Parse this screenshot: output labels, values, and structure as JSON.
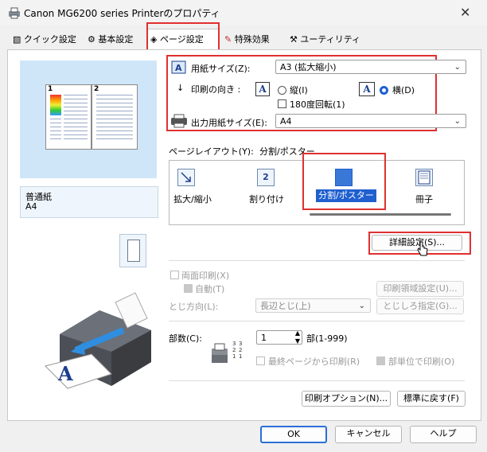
{
  "window": {
    "title": "Canon MG6200 series Printerのプロパティ",
    "close": "✕"
  },
  "tabs": [
    {
      "label": "クイック設定"
    },
    {
      "label": "基本設定"
    },
    {
      "label": "ページ設定"
    },
    {
      "label": "特殊効果"
    },
    {
      "label": "ユーティリティ"
    }
  ],
  "preview": {
    "page1": "1",
    "page2": "2"
  },
  "paper_info": {
    "type": "普通紙",
    "size": "A4"
  },
  "page_size": {
    "label": "用紙サイズ(Z):",
    "value": "A3 (拡大縮小)"
  },
  "orientation": {
    "label": "印刷の向き :",
    "portrait": "縦(I)",
    "landscape": "横(D)",
    "rotate": "180度回転(1)",
    "icon": "A"
  },
  "output_size": {
    "label": "出力用紙サイズ(E):",
    "value": "A4"
  },
  "page_layout": {
    "label": "ページレイアウト(Y):",
    "value": "分割/ポスター",
    "items": [
      {
        "label": "拡大/縮小"
      },
      {
        "label": "割り付け"
      },
      {
        "label": "分割/ポスター"
      },
      {
        "label": "冊子"
      }
    ],
    "icon2": "2"
  },
  "details_button": "詳細設定(S)...",
  "duplex": {
    "label": "両面印刷(X)",
    "auto": "自動(T)",
    "area_button": "印刷領域設定(U)...",
    "binding_label": "とじ方向(L):",
    "binding_value": "長辺とじ(上)",
    "margin_button": "とじしろ指定(G)..."
  },
  "copies": {
    "label": "部数(C):",
    "value": "1",
    "range": "部(1-999)",
    "last_page": "最終ページから印刷(R)",
    "collate": "部単位で印刷(O)"
  },
  "bottom_buttons": {
    "print_options": "印刷オプション(N)...",
    "defaults": "標準に戻す(F)"
  },
  "dialog_buttons": {
    "ok": "OK",
    "cancel": "キャンセル",
    "help": "ヘルプ"
  },
  "colors": {
    "highlight": "#1f5fcf",
    "red_outline": "#e03030",
    "preview_bg": "#cfe6f8"
  }
}
